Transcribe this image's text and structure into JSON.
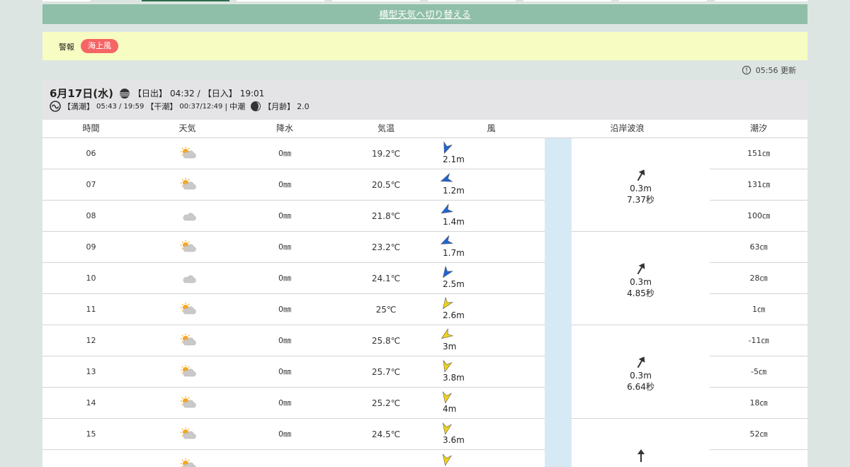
{
  "switch_link": "横型天気へ切り替える",
  "alert": {
    "label": "警報",
    "badges": [
      "海上風"
    ]
  },
  "update": {
    "time": "05:56",
    "label": "更新"
  },
  "day": {
    "date": "6月17日(水)",
    "sunrise_label": "【日出】",
    "sunrise": "04:32",
    "sep": "/",
    "sunset_label": "【日入】",
    "sunset": "19:01",
    "high_tide_label": "【満潮】",
    "high_tide": "05:43 / 19:59",
    "low_tide_label": "【干潮】",
    "low_tide": "00:37/12:49",
    "bar": "|",
    "tide_type": "中潮",
    "moon_age_label": "【月齢】",
    "moon_age": "2.0"
  },
  "columns": [
    "時間",
    "天気",
    "降水",
    "気温",
    "風",
    "沿岸波浪",
    "潮汐"
  ],
  "rows": [
    {
      "hour": "06",
      "weather": "sunny-cloudy",
      "rain": "0㎜",
      "temp": "19.2℃",
      "wind_dir": 200,
      "wind_color": "#1f63d8",
      "wind": "2.1m",
      "tide": "151㎝"
    },
    {
      "hour": "07",
      "weather": "sunny-cloudy",
      "rain": "0㎜",
      "temp": "20.5℃",
      "wind_dir": 250,
      "wind_color": "#1f63d8",
      "wind": "1.2m",
      "tide": "131㎝"
    },
    {
      "hour": "08",
      "weather": "cloudy",
      "rain": "0㎜",
      "temp": "21.8℃",
      "wind_dir": 240,
      "wind_color": "#1f63d8",
      "wind": "1.4m",
      "tide": "100㎝"
    },
    {
      "hour": "09",
      "weather": "sunny-cloudy",
      "rain": "0㎜",
      "temp": "23.2℃",
      "wind_dir": 245,
      "wind_color": "#1f63d8",
      "wind": "1.7m",
      "tide": "63㎝"
    },
    {
      "hour": "10",
      "weather": "cloudy",
      "rain": "0㎜",
      "temp": "24.1℃",
      "wind_dir": 215,
      "wind_color": "#1f63d8",
      "wind": "2.5m",
      "tide": "28㎝"
    },
    {
      "hour": "11",
      "weather": "sunny-cloudy",
      "rain": "0㎜",
      "temp": "25℃",
      "wind_dir": 215,
      "wind_color": "#f2d417",
      "wind": "2.6m",
      "tide": "1㎝"
    },
    {
      "hour": "12",
      "weather": "sunny-cloudy",
      "rain": "0㎜",
      "temp": "25.8℃",
      "wind_dir": 235,
      "wind_color": "#f2d417",
      "wind": "3m",
      "tide": "-11㎝"
    },
    {
      "hour": "13",
      "weather": "sunny-cloudy",
      "rain": "0㎜",
      "temp": "25.7℃",
      "wind_dir": 195,
      "wind_color": "#f2d417",
      "wind": "3.8m",
      "tide": "-5㎝"
    },
    {
      "hour": "14",
      "weather": "sunny-cloudy",
      "rain": "0㎜",
      "temp": "25.2℃",
      "wind_dir": 190,
      "wind_color": "#f2d417",
      "wind": "4m",
      "tide": "18㎝"
    },
    {
      "hour": "15",
      "weather": "sunny-cloudy",
      "rain": "0㎜",
      "temp": "24.5℃",
      "wind_dir": 190,
      "wind_color": "#f2d417",
      "wind": "3.6m",
      "tide": "52㎝"
    },
    {
      "hour": "",
      "weather": "sunny-cloudy",
      "rain": "",
      "temp": "",
      "wind_dir": 190,
      "wind_color": "#f2d417",
      "wind": "",
      "tide": ""
    }
  ],
  "waves": [
    {
      "height": "0.3m",
      "period": "7.37秒",
      "dir": 30
    },
    {
      "height": "0.3m",
      "period": "4.85秒",
      "dir": 30
    },
    {
      "height": "0.3m",
      "period": "6.64秒",
      "dir": 30
    },
    {
      "height": "",
      "period": "",
      "dir": 0
    }
  ]
}
